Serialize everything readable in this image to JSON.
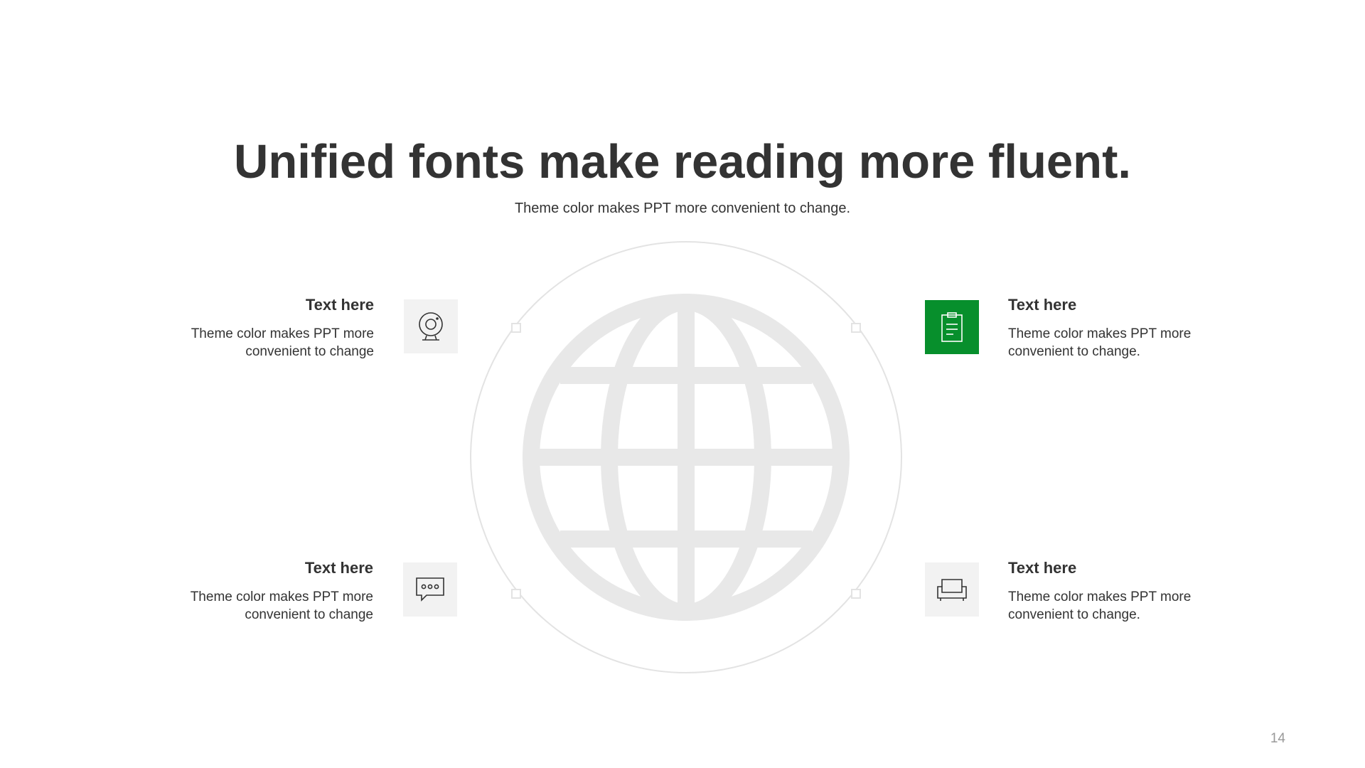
{
  "slide": {
    "title": "Unified fonts make reading more fluent.",
    "subtitle": "Theme color makes PPT more convenient  to change.",
    "page_number": "14",
    "accent_color": "#078f2c",
    "items": [
      {
        "heading": "Text here",
        "desc_line1": "Theme  color makes  PPT more",
        "desc_line2": "convenient  to change",
        "icon": "webcam-icon"
      },
      {
        "heading": "Text here",
        "desc_line1": "Theme  color makes  PPT more",
        "desc_line2": "convenient  to change.",
        "icon": "clipboard-icon"
      },
      {
        "heading": "Text here",
        "desc_line1": "Theme  color makes  PPT more",
        "desc_line2": "convenient  to change",
        "icon": "chat-bubble-icon"
      },
      {
        "heading": "Text here",
        "desc_line1": "Theme  color makes  PPT more",
        "desc_line2": "convenient  to change.",
        "icon": "armchair-icon"
      }
    ],
    "center_icon": "globe-icon"
  }
}
